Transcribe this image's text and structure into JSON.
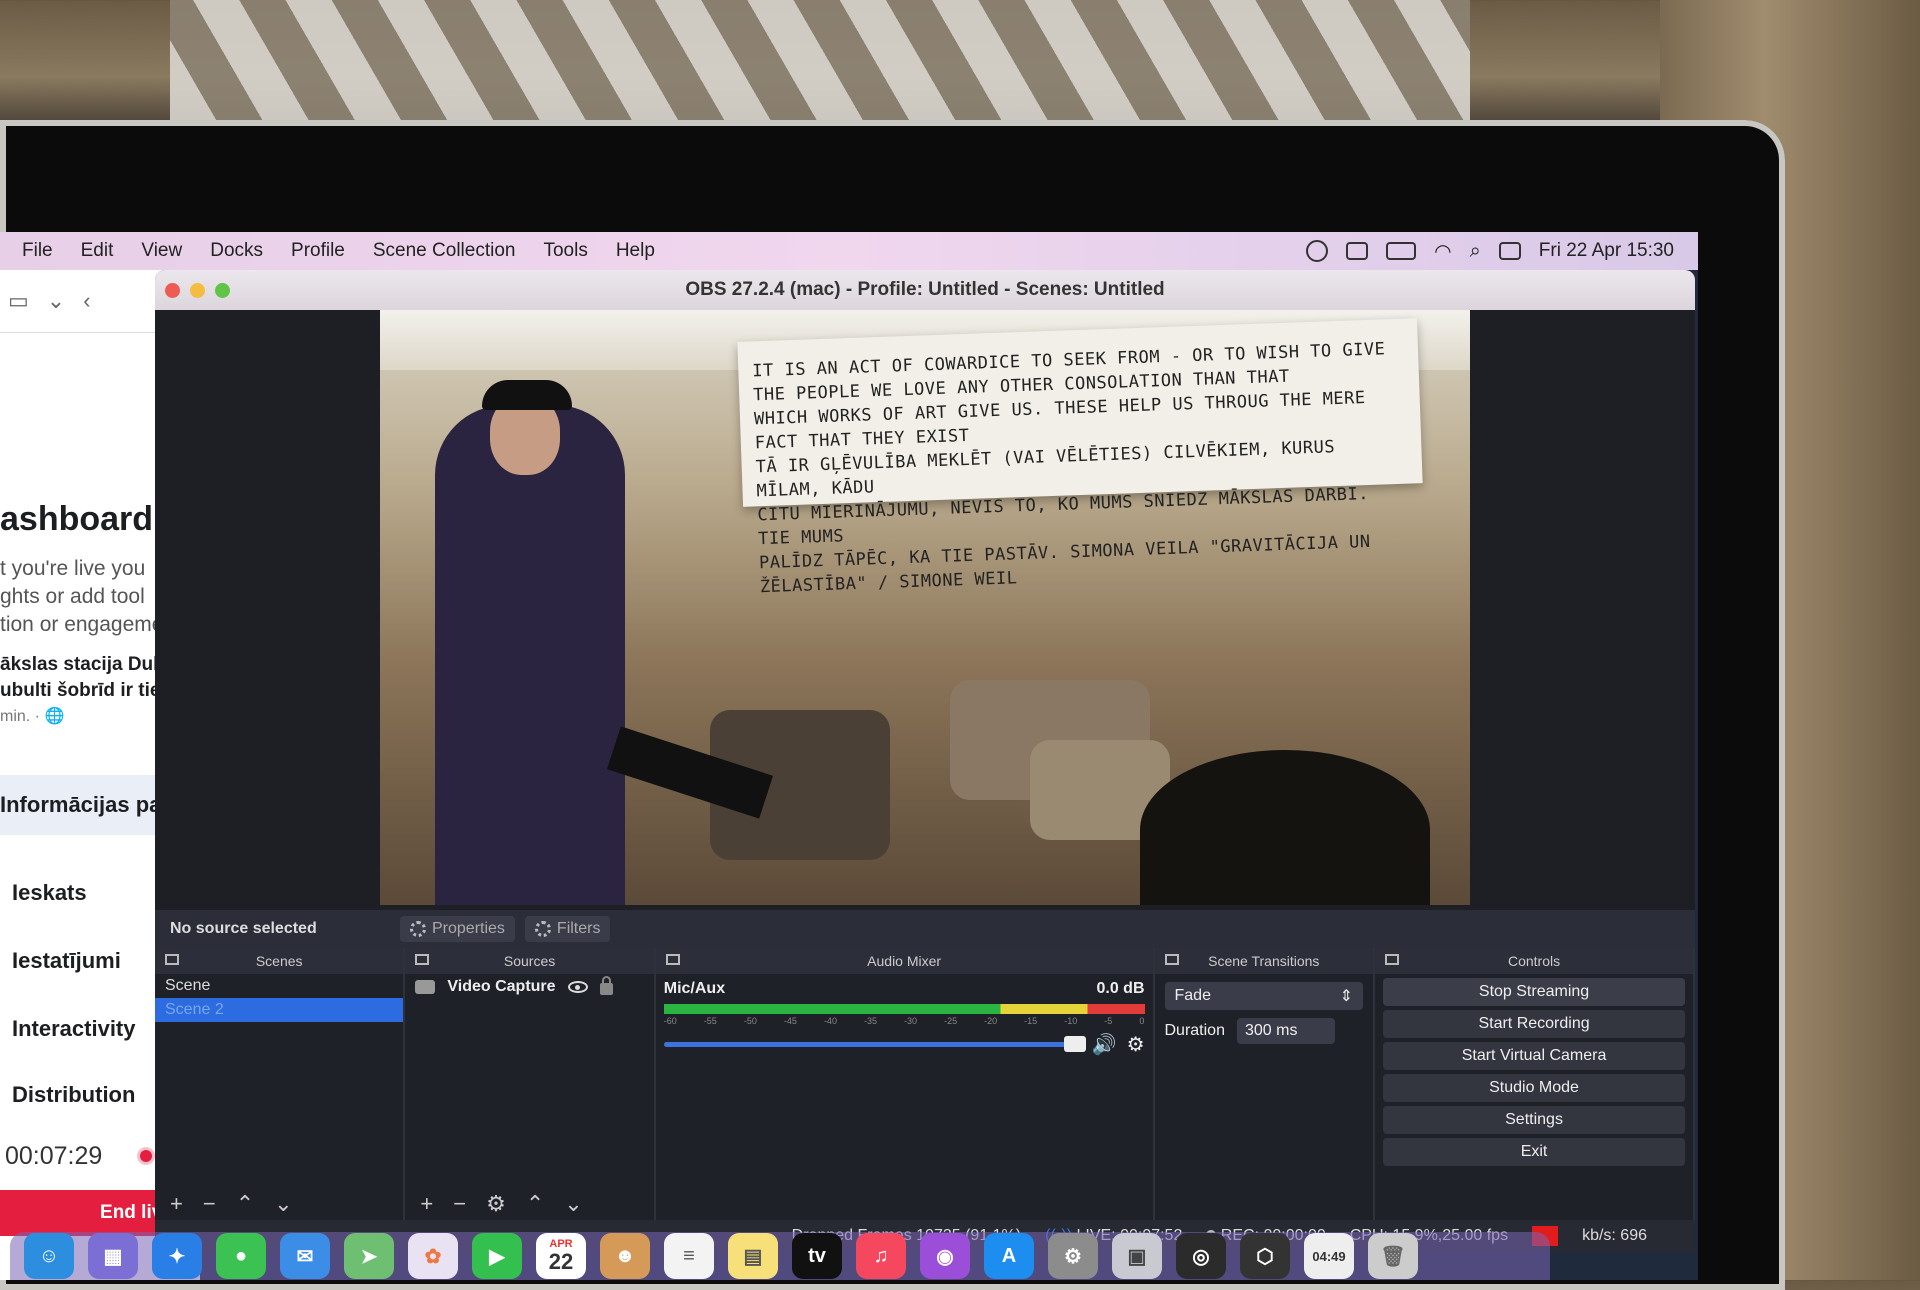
{
  "menubar": {
    "items": [
      "File",
      "Edit",
      "View",
      "Docks",
      "Profile",
      "Scene Collection",
      "Tools",
      "Help"
    ],
    "datetime": "Fri 22 Apr  15:30"
  },
  "bgapp": {
    "title": "ashboard",
    "desc": "t you're live you\nghts or add tool\ntion or engageme",
    "pagename": "ākslas stacija Dub\nubulti šobrīd ir tieš",
    "pagesub": "min. · 🌐",
    "nav_selected": "Informācijas pane",
    "nav": [
      "Ieskats",
      "Iestatījumi",
      "Interactivity",
      "Distribution"
    ],
    "timer": "00:07:29",
    "end_live": "End live vi"
  },
  "obs": {
    "title": "OBS 27.2.4 (mac) - Profile: Untitled - Scenes: Untitled",
    "banner_text": "IT IS AN ACT OF COWARDICE TO SEEK FROM - OR TO WISH TO GIVE\nTHE PEOPLE WE LOVE ANY OTHER CONSOLATION THAN THAT\nWHICH WORKS OF ART GIVE US. THESE HELP US THROUG THE MERE FACT THAT THEY EXIST\nTĀ IR GĻĒVULĪBA MEKLĒT (VAI VĒLĒTIES) CILVĒKIEM, KURUS MĪLAM, KĀDU\nCITU MIERINĀJUMU, NEVIS TO, KO MUMS SNIEDZ MĀKSLAS DARBI. TIE MUMS\nPALĪDZ TĀPĒC, KA TIE PASTĀV.  SIMONA VEILA \"GRAVITĀCIJA UN ŽĒLASTĪBA\" / SIMONE WEIL",
    "no_source": "No source selected",
    "properties": "Properties",
    "filters": "Filters",
    "docks": {
      "scenes": "Scenes",
      "sources": "Sources",
      "mixer": "Audio Mixer",
      "transitions": "Scene Transitions",
      "controls": "Controls"
    },
    "scenes": [
      "Scene",
      "Scene 2"
    ],
    "sources": [
      "Video Capture"
    ],
    "mixer": {
      "channel": "Mic/Aux",
      "db": "0.0 dB",
      "scale": [
        "-60",
        "-55",
        "-50",
        "-45",
        "-40",
        "-35",
        "-30",
        "-25",
        "-20",
        "-15",
        "-10",
        "-5",
        "0"
      ],
      "volume_percent": 100
    },
    "transition": {
      "type": "Fade",
      "duration_label": "Duration",
      "duration": "300 ms"
    },
    "controls": [
      "Stop Streaming",
      "Start Recording",
      "Start Virtual Camera",
      "Studio Mode",
      "Settings",
      "Exit"
    ],
    "status": {
      "dropped": "Dropped Frames 10735 (91.1%)",
      "live": "LIVE: 00:07:52",
      "rec": "REC: 00:00:00",
      "cpu": "CPU: 15.9%,25.00 fps",
      "kbps": "kb/s: 696"
    }
  },
  "dock": {
    "calendar_month": "APR",
    "calendar_day": "22",
    "tv": "tv",
    "clock": "04:49"
  },
  "colors": {
    "accent": "#2c6ce0",
    "live": "#e41e3f"
  }
}
